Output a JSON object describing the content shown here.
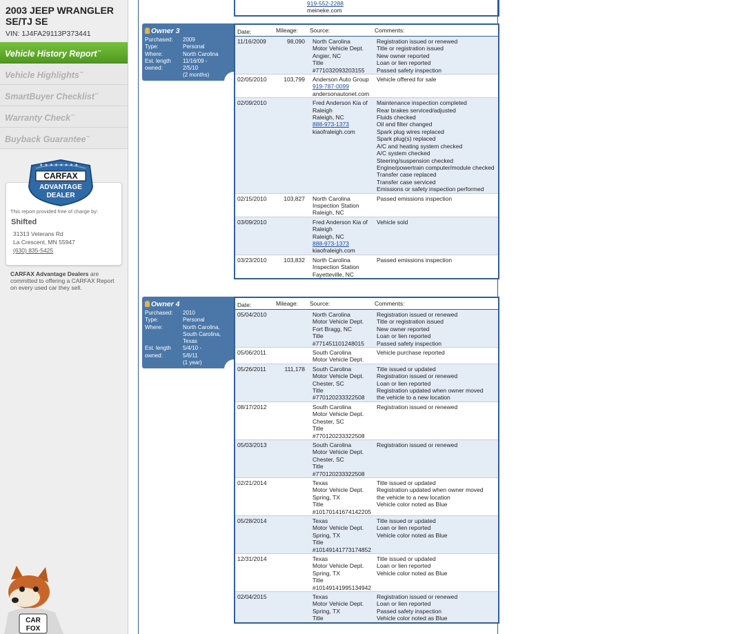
{
  "vehicle": {
    "title_line1": "2003 JEEP WRANGLER",
    "title_line2": "SE/TJ SE",
    "vin": "VIN: 1J4FA29113P373441"
  },
  "nav": [
    {
      "label": "Vehicle History Report",
      "tm": "™",
      "active": true
    },
    {
      "label": "Vehicle Highlights",
      "tm": "™",
      "active": false
    },
    {
      "label": "SmartBuyer Checklist",
      "tm": "™",
      "active": false
    },
    {
      "label": "Warranty Check",
      "tm": "™",
      "active": false
    },
    {
      "label": "Buyback Guarantee",
      "tm": "™",
      "active": false
    }
  ],
  "badge": {
    "line1": "CARFAX",
    "line2": "ADVANTAGE",
    "line3": "DEALER"
  },
  "dealer": {
    "provided_by": "This report provided free of charge by:",
    "name": "Shifted",
    "address1": "31313 Veterans Rd",
    "address2": "La Crescent, MN 55947",
    "phone": "(630) 835-5425"
  },
  "dealer_note": {
    "bold": "CARFAX Advantage Dealers",
    "rest1": " are",
    "rest2": "committed to offering a CARFAX Report",
    "rest3": "on every used car they sell."
  },
  "fox": {
    "text1": "CAR",
    "text2": "FOX"
  },
  "top_fragment": {
    "phone": "919-552-2288",
    "site": "meineke.com"
  },
  "columns": {
    "date": "Date:",
    "mileage": "Mileage:",
    "source": "Source:",
    "comments": "Comments:"
  },
  "owner3": {
    "title": "Owner 3",
    "fields": [
      {
        "k": "Purchased:",
        "v": [
          "2009"
        ]
      },
      {
        "k": "Type:",
        "v": [
          "Personal"
        ]
      },
      {
        "k": "Where:",
        "v": [
          "North Carolina"
        ]
      },
      {
        "k": "Est. length owned:",
        "v": [
          "11/16/09 -",
          "2/5/10",
          "(2 months)"
        ]
      }
    ],
    "rows": [
      {
        "date": "11/16/2009",
        "mileage": "98,090",
        "source": [
          "North Carolina",
          "Motor Vehicle Dept.",
          "Angier, NC",
          "Title",
          "#771032093203155"
        ],
        "comments": [
          "Registration issued or renewed",
          "Title or registration issued",
          "New owner reported",
          "Loan or lien reported",
          "Passed safety inspection"
        ]
      },
      {
        "date": "02/05/2010",
        "mileage": "103,799",
        "source": [
          "Anderson Auto Group",
          "919-787-0099",
          "andersonautonet.com"
        ],
        "comments": [
          "Vehicle offered for sale"
        ]
      },
      {
        "date": "02/09/2010",
        "mileage": "",
        "source": [
          "Fred Anderson Kia of",
          "Raleigh",
          "Raleigh, NC",
          "888-973-1373",
          "kiaofraleigh.com"
        ],
        "comments": [
          "Maintenance inspection completed",
          "Rear brakes serviced/adjusted",
          "Fluids checked",
          "Oil and filter changed",
          "Spark plug wires replaced",
          "Spark plug(s) replaced",
          "A/C and heating system checked",
          "A/C system checked",
          "Steering/suspension checked",
          "Engine/powertrain computer/module checked",
          "Transfer case replaced",
          "Transfer case serviced",
          "Emissions or safety inspection performed"
        ]
      },
      {
        "date": "02/15/2010",
        "mileage": "103,827",
        "source": [
          "North Carolina",
          "Inspection Station",
          "Raleigh, NC"
        ],
        "comments": [
          "Passed emissions inspection"
        ]
      },
      {
        "date": "03/09/2010",
        "mileage": "",
        "source": [
          "Fred Anderson Kia of",
          "Raleigh",
          "Raleigh, NC",
          "888-973-1373",
          "kiaofraleigh.com"
        ],
        "comments": [
          "Vehicle sold"
        ]
      },
      {
        "date": "03/23/2010",
        "mileage": "103,832",
        "source": [
          "North Carolina",
          "Inspection Station",
          "Fayetteville, NC"
        ],
        "comments": [
          "Passed emissions inspection"
        ]
      }
    ]
  },
  "owner4": {
    "title": "Owner 4",
    "fields": [
      {
        "k": "Purchased:",
        "v": [
          "2010"
        ]
      },
      {
        "k": "Type:",
        "v": [
          "Personal"
        ]
      },
      {
        "k": "Where:",
        "v": [
          "North Carolina,",
          "South Carolina,",
          "Texas"
        ]
      },
      {
        "k": "Est. length",
        "v": [
          "5/4/10 -"
        ]
      },
      {
        "k": "owned:",
        "v": [
          "5/6/11",
          "(1 year)"
        ]
      }
    ],
    "rows": [
      {
        "date": "05/04/2010",
        "mileage": "",
        "source": [
          "North Carolina",
          "Motor Vehicle Dept.",
          "Fort Bragg, NC",
          "Title",
          "#771451101248015"
        ],
        "comments": [
          "Registration issued or renewed",
          "Title or registration issued",
          "New owner reported",
          "Loan or lien reported",
          "Passed safety inspection"
        ]
      },
      {
        "date": "05/06/2011",
        "mileage": "",
        "source": [
          "South Carolina",
          "Motor Vehicle Dept."
        ],
        "comments": [
          "Vehicle purchase reported"
        ]
      },
      {
        "date": "05/26/2011",
        "mileage": "111,178",
        "source": [
          "South Carolina",
          "Motor Vehicle Dept.",
          "Chester, SC",
          "Title",
          "#770120233322508"
        ],
        "comments": [
          "Title issued or updated",
          "Registration issued or renewed",
          "Loan or lien reported",
          "Registration updated when owner moved",
          "the vehicle to a new location"
        ]
      },
      {
        "date": "08/17/2012",
        "mileage": "",
        "source": [
          "South Carolina",
          "Motor Vehicle Dept.",
          "Chester, SC",
          "Title",
          "#770120233322508"
        ],
        "comments": [
          "Registration issued or renewed"
        ]
      },
      {
        "date": "05/03/2013",
        "mileage": "",
        "source": [
          "South Carolina",
          "Motor Vehicle Dept.",
          "Chester, SC",
          "Title",
          "#770120233322508"
        ],
        "comments": [
          "Registration issued or renewed"
        ]
      },
      {
        "date": "02/21/2014",
        "mileage": "",
        "source": [
          "Texas",
          "Motor Vehicle Dept.",
          "Spring, TX",
          "Title",
          "#10170141674142205"
        ],
        "comments": [
          "Title issued or updated",
          "Registration updated when owner moved",
          "the vehicle to a new location",
          "Vehicle color noted as Blue"
        ]
      },
      {
        "date": "05/28/2014",
        "mileage": "",
        "source": [
          "Texas",
          "Motor Vehicle Dept.",
          "Spring, TX",
          "Title",
          "#10149141773174852"
        ],
        "comments": [
          "Title issued or updated",
          "Loan or lien reported",
          "Vehicle color noted as Blue"
        ]
      },
      {
        "date": "12/31/2014",
        "mileage": "",
        "source": [
          "Texas",
          "Motor Vehicle Dept.",
          "Spring, TX",
          "Title",
          "#10149141995134942"
        ],
        "comments": [
          "Title issued or updated",
          "Loan or lien reported",
          "Vehicle color noted as Blue"
        ]
      },
      {
        "date": "02/04/2015",
        "mileage": "",
        "source": [
          "Texas",
          "Motor Vehicle Dept.",
          "Spring, TX",
          "Title"
        ],
        "comments": [
          "Registration issued or renewed",
          "Loan or lien reported",
          "Passed safety inspection",
          "Vehicle color noted as Blue"
        ]
      }
    ]
  }
}
